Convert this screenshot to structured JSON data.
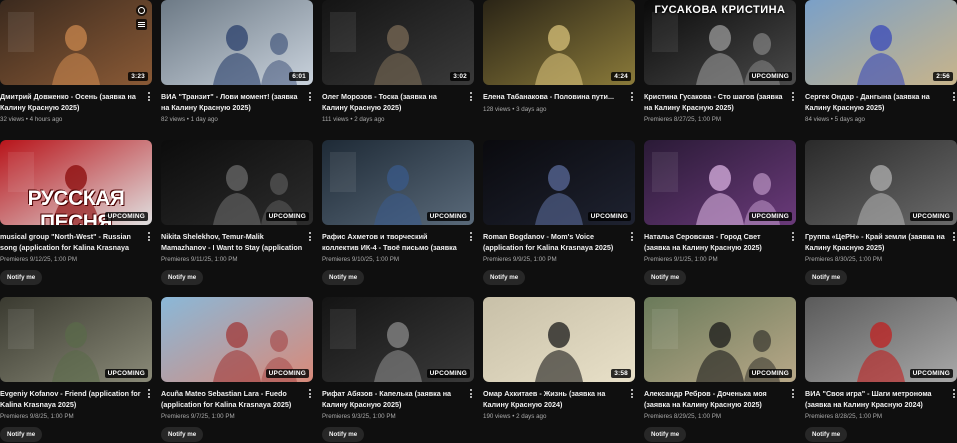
{
  "badges": {
    "upcoming": "UPCOMING"
  },
  "cards": [
    {
      "title": "Дмитрий Довженко - Осень (заявка на Калину Красную 2025)",
      "sub": "32 views • 4 hours ago",
      "duration": "3:23",
      "notify": "",
      "thumb": {
        "icon": "autumn-park-thumbnail",
        "c1": "#3b2a1e",
        "c2": "#8a5a36",
        "accent": "#c9874e"
      }
    },
    {
      "title": "ВИА \"Транзит\" - Лови момент! (заявка на Калину Красную 2025)",
      "sub": "82 views • 1 day ago",
      "duration": "6:01",
      "notify": "",
      "thumb": {
        "icon": "band-room-thumbnail",
        "c1": "#6d7a86",
        "c2": "#c9d2dc",
        "accent": "#2a3f6b"
      }
    },
    {
      "title": "Олег Морозов - Тоска (заявка на Калину Красную 2025)",
      "sub": "111 views • 2 days ago",
      "duration": "3:02",
      "notify": "",
      "thumb": {
        "icon": "guitar-singer-thumbnail",
        "c1": "#141414",
        "c2": "#3a3a3a",
        "accent": "#7a6a55"
      }
    },
    {
      "title": "Елена Табанакова - Половина пути...",
      "sub": "128 views • 3 days ago",
      "duration": "4:24",
      "notify": "",
      "thumb": {
        "icon": "singer-guitar-thumbnail",
        "c1": "#2a2416",
        "c2": "#8a7a3a",
        "accent": "#d8c27a"
      }
    },
    {
      "title": "Кристина Гусакова - Сто шагов (заявка на Калину Красную 2025)",
      "sub": "Premieres 8/27/25, 1:00 PM",
      "duration": "UPCOMING",
      "notify": "",
      "thumb": {
        "icon": "portrait-thumbnail",
        "c1": "#0a0a0a",
        "c2": "#4a4a4a",
        "accent": "#9a9a9a",
        "label": "ГУСАКОВА КРИСТИНА"
      }
    },
    {
      "title": "Сергек Ондар - Дангына (заявка на Калину Красную 2025)",
      "sub": "84 views • 5 days ago",
      "duration": "2:56",
      "notify": "",
      "thumb": {
        "icon": "folk-costume-thumbnail",
        "c1": "#7aa0c8",
        "c2": "#c8b48a",
        "accent": "#3a4ab8"
      }
    },
    {
      "title": "musical group \"North-West\" - Russian song (application for Kalina Krasnaya 2025)",
      "sub": "Premieres 9/12/25, 1:00 PM",
      "duration": "UPCOMING",
      "notify": "Notify me",
      "thumb": {
        "icon": "choir-banner-thumbnail",
        "c1": "#b8141a",
        "c2": "#e0e0e0",
        "accent": "#8a0a0a",
        "label": "РУССКАЯ ПЕСНЯ"
      }
    },
    {
      "title": "Nikita Shelekhov, Temur-Malik Mamazhanov - I Want to Stay (application for Kalina...",
      "sub": "Premieres 9/11/25, 1:00 PM",
      "duration": "UPCOMING",
      "notify": "Notify me",
      "thumb": {
        "icon": "dark-portrait-thumbnail",
        "c1": "#0c0c0c",
        "c2": "#2c2c2c",
        "accent": "#6a6a6a"
      }
    },
    {
      "title": "Рафис Ахметов и творческий коллектив ИК-4 - Твоё письмо (заявка на Калину...",
      "sub": "Premieres 9/10/25, 1:00 PM",
      "duration": "UPCOMING",
      "notify": "Notify me",
      "thumb": {
        "icon": "workshop-thumbnail",
        "c1": "#1e2a36",
        "c2": "#5a6a7a",
        "accent": "#3a5a8a"
      }
    },
    {
      "title": "Roman Bogdanov - Mom's Voice (application for Kalina Krasnaya 2025)",
      "sub": "Premieres 9/9/25, 1:00 PM",
      "duration": "UPCOMING",
      "notify": "Notify me",
      "thumb": {
        "icon": "stage-singer-thumbnail",
        "c1": "#0a0a0e",
        "c2": "#1e2230",
        "accent": "#5a6a9a"
      }
    },
    {
      "title": "Наталья Серовская - Город Свет (заявка на Калину Красную 2025)",
      "sub": "Premieres 9/1/25, 1:00 PM",
      "duration": "UPCOMING",
      "notify": "Notify me",
      "thumb": {
        "icon": "keyboard-thumbnail",
        "c1": "#2a1a36",
        "c2": "#6a3a7a",
        "accent": "#d8b0e0"
      }
    },
    {
      "title": "Группа «ЦеРН» - Край земли (заявка на Калину Красную 2025)",
      "sub": "Premieres 8/30/25, 1:00 PM",
      "duration": "UPCOMING",
      "notify": "Notify me",
      "thumb": {
        "icon": "studio-band-thumbnail",
        "c1": "#2a2a2a",
        "c2": "#6a6a6a",
        "accent": "#b0b0b0"
      }
    },
    {
      "title": "Evgeniy Kofanov - Friend (application for Kalina Krasnaya 2025)",
      "sub": "Premieres 9/8/25, 1:00 PM",
      "duration": "UPCOMING",
      "notify": "Notify me",
      "thumb": {
        "icon": "kitchen-scene-thumbnail",
        "c1": "#3a3a30",
        "c2": "#8a8a78",
        "accent": "#5a6a4a"
      }
    },
    {
      "title": "Acuña Mateo Sebastian Lara - Fuedo (application for Kalina Krasnaya 2025)",
      "sub": "Premieres 9/7/25, 1:00 PM",
      "duration": "UPCOMING",
      "notify": "Notify me",
      "thumb": {
        "icon": "duo-portrait-thumbnail",
        "c1": "#8ab8d8",
        "c2": "#d88a7a",
        "accent": "#a03a3a"
      }
    },
    {
      "title": "Рифат Абязов - Капелька (заявка на Калину Красную 2025)",
      "sub": "Premieres 9/3/25, 1:00 PM",
      "duration": "UPCOMING",
      "notify": "Notify me",
      "thumb": {
        "icon": "guitarist-dark-thumbnail",
        "c1": "#141414",
        "c2": "#3a3a3a",
        "accent": "#8a8a8a"
      }
    },
    {
      "title": "Омар Ахкитаев - Жизнь (заявка на Калину Красную 2024)",
      "sub": "190 views • 2 days ago",
      "duration": "3:58",
      "notify": "",
      "thumb": {
        "icon": "duo-guitar-thumbnail",
        "c1": "#c8c0a8",
        "c2": "#e8e0c8",
        "accent": "#1a1a1a"
      }
    },
    {
      "title": "Александр Ребров - Доченька моя (заявка на Калину Красную 2025)",
      "sub": "Premieres 8/29/25, 1:00 PM",
      "duration": "UPCOMING",
      "notify": "Notify me",
      "thumb": {
        "icon": "room-portrait-thumbnail",
        "c1": "#6a7a5a",
        "c2": "#b8a888",
        "accent": "#1a1a1a"
      }
    },
    {
      "title": "ВИА \"Своя игра\" - Шаги метронома (заявка на Калину Красную 2024)",
      "sub": "Premieres 8/28/25, 1:00 PM",
      "duration": "UPCOMING",
      "notify": "Notify me",
      "thumb": {
        "icon": "band-guitar-thumbnail",
        "c1": "#5a5a5a",
        "c2": "#a8a8a8",
        "accent": "#c02020"
      }
    }
  ]
}
